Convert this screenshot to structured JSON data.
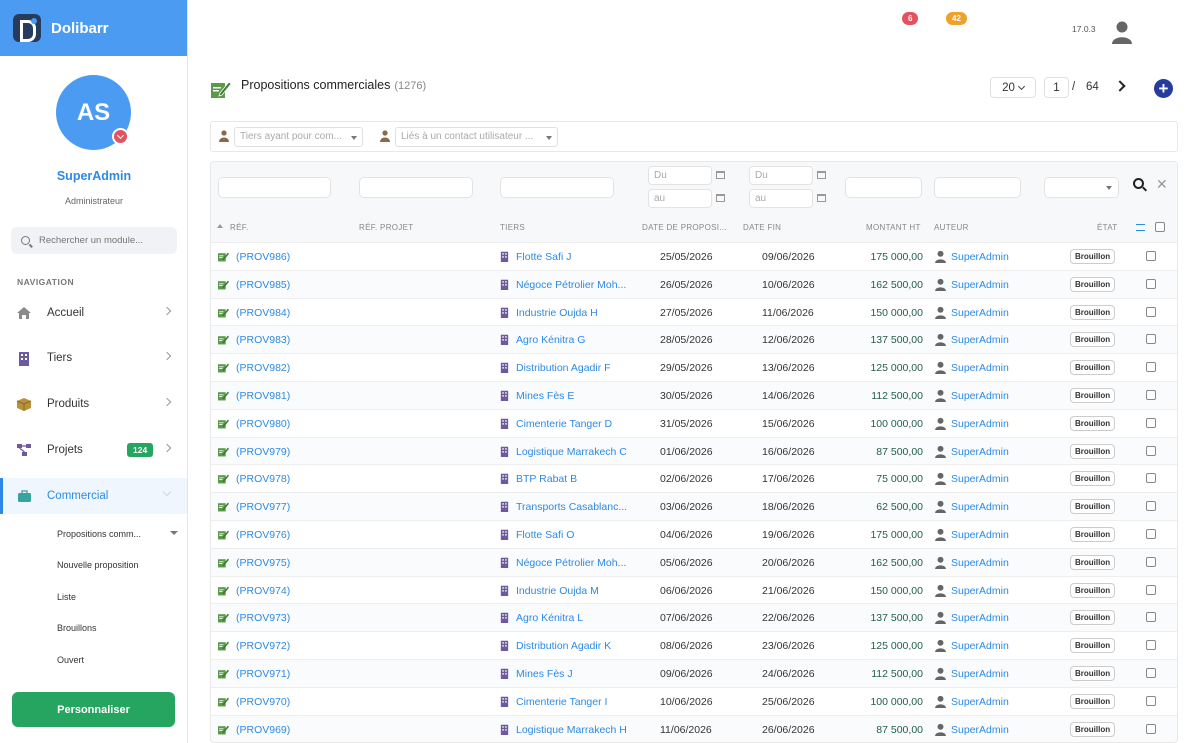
{
  "brand": {
    "name": "Dolibarr"
  },
  "user": {
    "initials": "AS",
    "name": "SuperAdmin",
    "role": "Administrateur"
  },
  "module_search": {
    "placeholder": "Rechercher un module..."
  },
  "nav": {
    "header": "NAVIGATION",
    "items": [
      {
        "label": "Accueil"
      },
      {
        "label": "Tiers"
      },
      {
        "label": "Produits"
      },
      {
        "label": "Projets",
        "badge": "124"
      },
      {
        "label": "Commercial"
      }
    ],
    "sub_items": [
      {
        "label": "Propositions comm..."
      },
      {
        "label": "Nouvelle proposition"
      },
      {
        "label": "Liste"
      },
      {
        "label": "Brouillons"
      },
      {
        "label": "Ouvert"
      }
    ],
    "customize_label": "Personnaliser"
  },
  "topbar": {
    "badge_red": "6",
    "badge_orange": "42",
    "version": "17.0.3"
  },
  "page": {
    "title": "Propositions commerciales",
    "count": "(1276)",
    "per_page": "20",
    "current_page": "1",
    "page_sep": "/",
    "total_pages": "64"
  },
  "filters": {
    "thirdparty_placeholder": "Tiers ayant pour com...",
    "contact_placeholder": "Liés à un contact utilisateur ..."
  },
  "date_filters": {
    "from": "Du",
    "to": "au"
  },
  "columns": {
    "ref": "RÉF.",
    "ref_project": "RÉF. PROJET",
    "tiers": "TIERS",
    "date_prop": "DATE DE PROPOSI...",
    "date_end": "DATE FIN",
    "amount": "MONTANT HT",
    "author": "AUTEUR",
    "status": "ÉTAT"
  },
  "rows": [
    {
      "ref": "(PROV986)",
      "tiers": "Flotte Safi J",
      "date": "25/05/2026",
      "date_end": "09/06/2026",
      "amount": "175 000,00",
      "author": "SuperAdmin",
      "status": "Brouillon"
    },
    {
      "ref": "(PROV985)",
      "tiers": "Négoce Pétrolier Moh...",
      "date": "26/05/2026",
      "date_end": "10/06/2026",
      "amount": "162 500,00",
      "author": "SuperAdmin",
      "status": "Brouillon"
    },
    {
      "ref": "(PROV984)",
      "tiers": "Industrie Oujda H",
      "date": "27/05/2026",
      "date_end": "11/06/2026",
      "amount": "150 000,00",
      "author": "SuperAdmin",
      "status": "Brouillon"
    },
    {
      "ref": "(PROV983)",
      "tiers": "Agro Kénitra G",
      "date": "28/05/2026",
      "date_end": "12/06/2026",
      "amount": "137 500,00",
      "author": "SuperAdmin",
      "status": "Brouillon"
    },
    {
      "ref": "(PROV982)",
      "tiers": "Distribution Agadir F",
      "date": "29/05/2026",
      "date_end": "13/06/2026",
      "amount": "125 000,00",
      "author": "SuperAdmin",
      "status": "Brouillon"
    },
    {
      "ref": "(PROV981)",
      "tiers": "Mines Fès E",
      "date": "30/05/2026",
      "date_end": "14/06/2026",
      "amount": "112 500,00",
      "author": "SuperAdmin",
      "status": "Brouillon"
    },
    {
      "ref": "(PROV980)",
      "tiers": "Cimenterie Tanger D",
      "date": "31/05/2026",
      "date_end": "15/06/2026",
      "amount": "100 000,00",
      "author": "SuperAdmin",
      "status": "Brouillon"
    },
    {
      "ref": "(PROV979)",
      "tiers": "Logistique Marrakech C",
      "date": "01/06/2026",
      "date_end": "16/06/2026",
      "amount": "87 500,00",
      "author": "SuperAdmin",
      "status": "Brouillon"
    },
    {
      "ref": "(PROV978)",
      "tiers": "BTP Rabat B",
      "date": "02/06/2026",
      "date_end": "17/06/2026",
      "amount": "75 000,00",
      "author": "SuperAdmin",
      "status": "Brouillon"
    },
    {
      "ref": "(PROV977)",
      "tiers": "Transports Casablanc...",
      "date": "03/06/2026",
      "date_end": "18/06/2026",
      "amount": "62 500,00",
      "author": "SuperAdmin",
      "status": "Brouillon"
    },
    {
      "ref": "(PROV976)",
      "tiers": "Flotte Safi O",
      "date": "04/06/2026",
      "date_end": "19/06/2026",
      "amount": "175 000,00",
      "author": "SuperAdmin",
      "status": "Brouillon"
    },
    {
      "ref": "(PROV975)",
      "tiers": "Négoce Pétrolier Moh...",
      "date": "05/06/2026",
      "date_end": "20/06/2026",
      "amount": "162 500,00",
      "author": "SuperAdmin",
      "status": "Brouillon"
    },
    {
      "ref": "(PROV974)",
      "tiers": "Industrie Oujda M",
      "date": "06/06/2026",
      "date_end": "21/06/2026",
      "amount": "150 000,00",
      "author": "SuperAdmin",
      "status": "Brouillon"
    },
    {
      "ref": "(PROV973)",
      "tiers": "Agro Kénitra L",
      "date": "07/06/2026",
      "date_end": "22/06/2026",
      "amount": "137 500,00",
      "author": "SuperAdmin",
      "status": "Brouillon"
    },
    {
      "ref": "(PROV972)",
      "tiers": "Distribution Agadir K",
      "date": "08/06/2026",
      "date_end": "23/06/2026",
      "amount": "125 000,00",
      "author": "SuperAdmin",
      "status": "Brouillon"
    },
    {
      "ref": "(PROV971)",
      "tiers": "Mines Fès J",
      "date": "09/06/2026",
      "date_end": "24/06/2026",
      "amount": "112 500,00",
      "author": "SuperAdmin",
      "status": "Brouillon"
    },
    {
      "ref": "(PROV970)",
      "tiers": "Cimenterie Tanger I",
      "date": "10/06/2026",
      "date_end": "25/06/2026",
      "amount": "100 000,00",
      "author": "SuperAdmin",
      "status": "Brouillon"
    },
    {
      "ref": "(PROV969)",
      "tiers": "Logistique Marrakech H",
      "date": "11/06/2026",
      "date_end": "26/06/2026",
      "amount": "87 500,00",
      "author": "SuperAdmin",
      "status": "Brouillon"
    }
  ],
  "colors": {
    "brand": "#4b9bf3",
    "link": "#2c8ae6",
    "green": "#25a55f",
    "badge_red": "#e4525f",
    "badge_orange": "#f0a12c"
  }
}
